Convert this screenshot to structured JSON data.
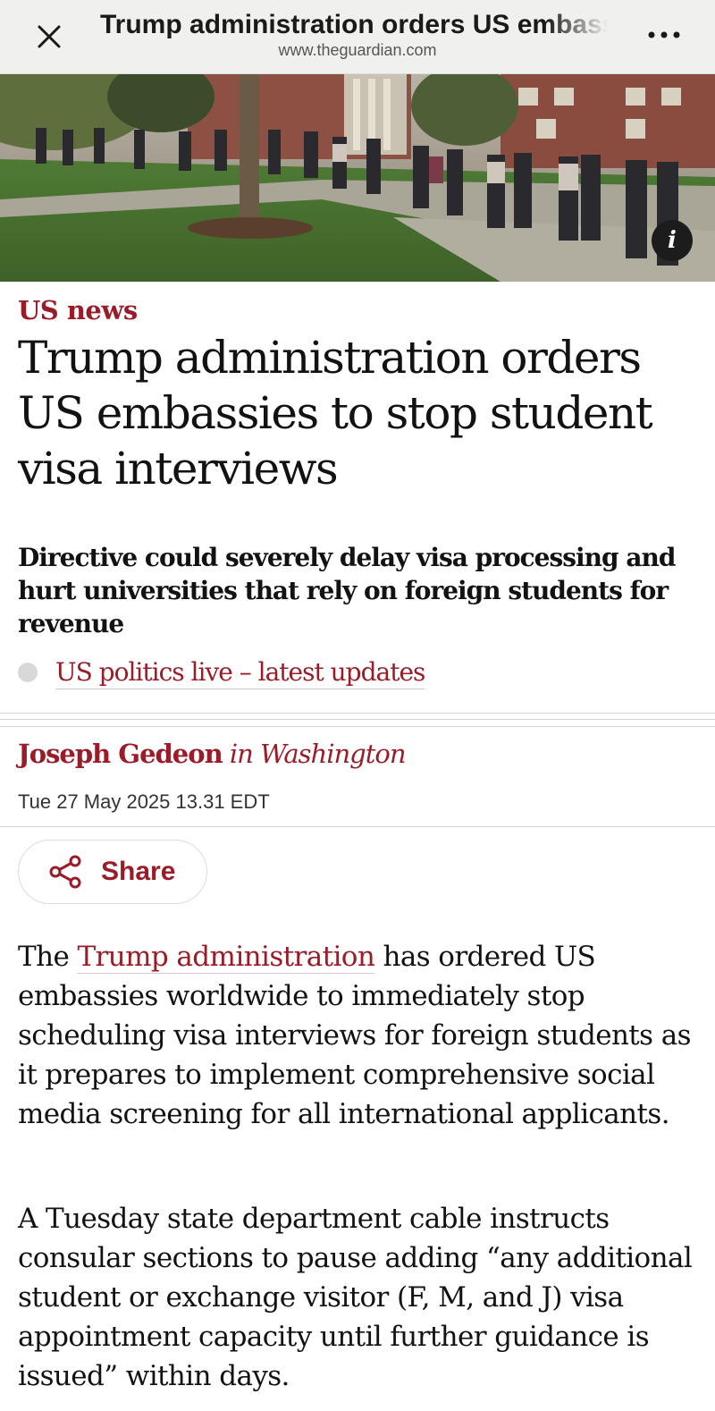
{
  "browser": {
    "title": "Trump administration orders US embassies to stop student visa interviews",
    "url": "www.theguardian.com",
    "close_icon": "close-icon",
    "more_icon": "more-options-icon"
  },
  "hero": {
    "info_label": "i"
  },
  "article": {
    "section": "US news",
    "headline": "Trump administration orders US embassies to stop student visa interviews",
    "standfirst": "Directive could severely delay visa processing and hurt universities that rely on foreign students for revenue",
    "live_link": "US politics live – latest updates",
    "byline": {
      "author": "Joseph Gedeon",
      "location": "in Washington"
    },
    "date": "Tue 27 May 2025 13.31 EDT",
    "share_label": "Share",
    "paragraphs": [
      {
        "before": "The ",
        "link": "Trump administration",
        "after": " has ordered US embassies worldwide to immediately stop scheduling visa interviews for foreign students as it prepares to implement comprehensive social media screening for all international applicants."
      },
      {
        "text": "A Tuesday state department cable instructs consular sections to pause adding “any additional student or exchange visitor (F, M, and J) visa appointment capacity until further guidance is issued” within days."
      }
    ]
  },
  "colors": {
    "accent": "#9a1c28",
    "text": "#121212",
    "topbar": "#f0f0ef"
  }
}
